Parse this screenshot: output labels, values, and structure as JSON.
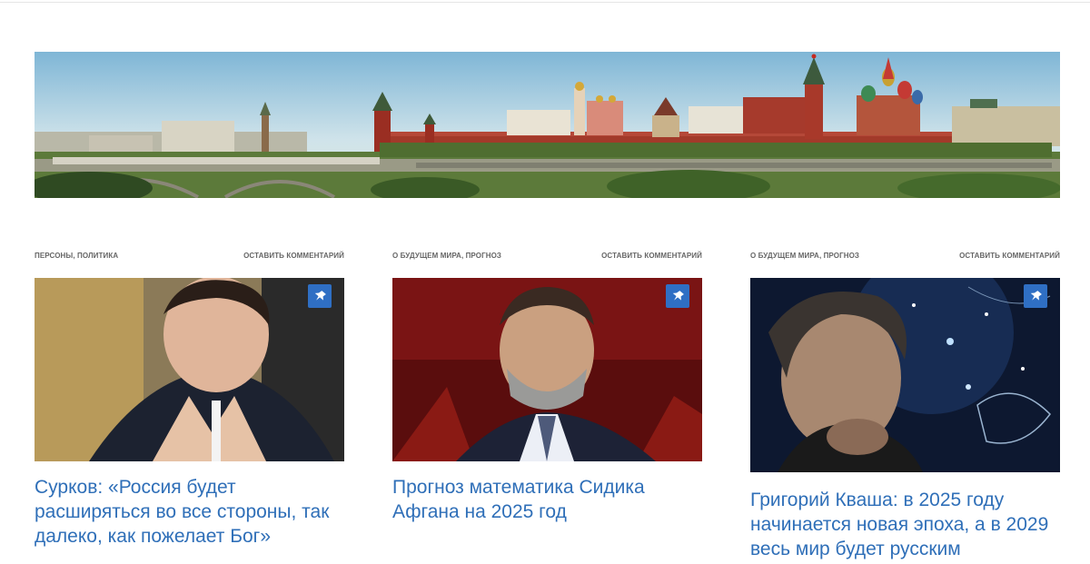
{
  "page": {
    "accent_color": "#2f6fc4",
    "title_color": "#2f6fb8"
  },
  "header": {
    "banner_alt": "Panorama of the Moscow Kremlin"
  },
  "posts": [
    {
      "categories": "ПЕРСОНЫ, ПОЛИТИКА",
      "comment_link": "ОСТАВИТЬ КОММЕНТАРИЙ",
      "title": "Сурков: «Россия будет расширяться во все стороны, так далеко, как пожелает Бог»",
      "sticky_icon": "pin-icon"
    },
    {
      "categories": "О БУДУЩЕМ МИРА, ПРОГНОЗ",
      "comment_link": "ОСТАВИТЬ КОММЕНТАРИЙ",
      "title": "Прогноз математика Сидика Афгана на 2025 год",
      "sticky_icon": "pin-icon"
    },
    {
      "categories": "О БУДУЩЕМ МИРА, ПРОГНОЗ",
      "comment_link": "ОСТАВИТЬ КОММЕНТАРИЙ",
      "title": "Григорий Кваша: в 2025 году начинается новая эпоха, а в 2029 весь мир будет русским",
      "sticky_icon": "pin-icon"
    }
  ]
}
